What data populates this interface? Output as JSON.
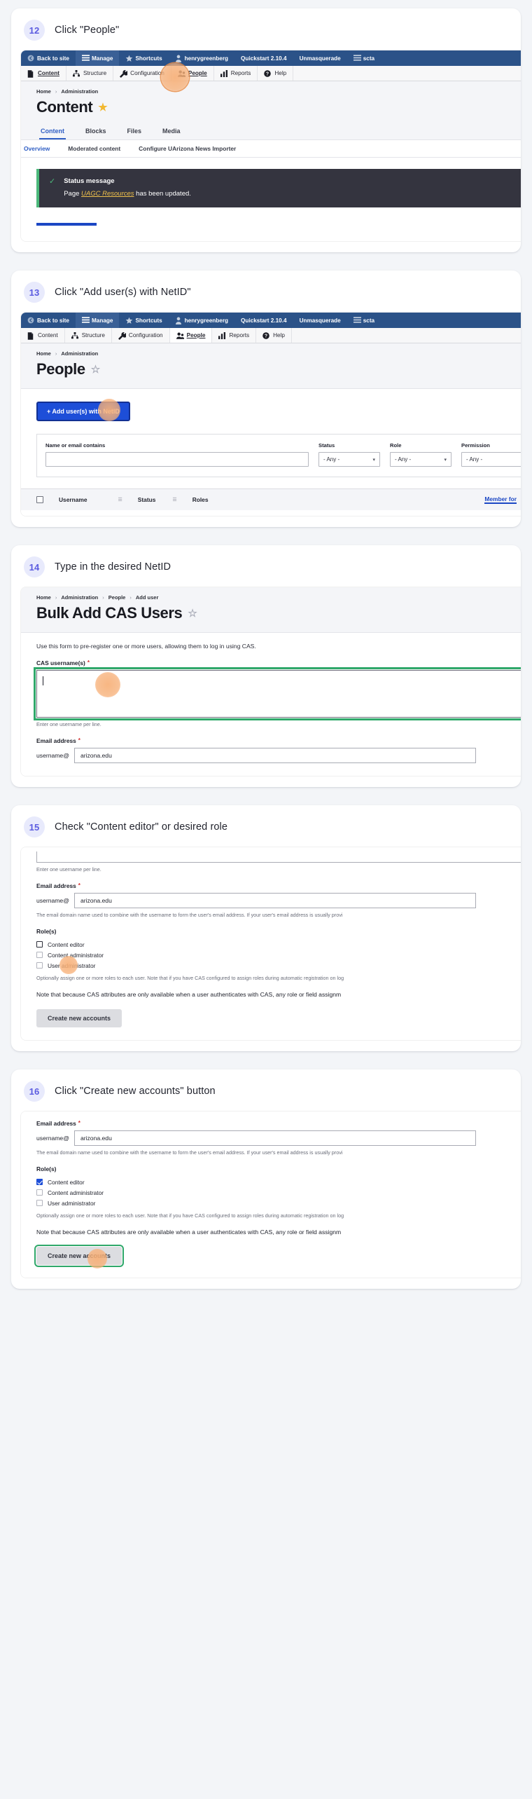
{
  "toolbar": {
    "back_to_site": "Back to site",
    "manage": "Manage",
    "shortcuts": "Shortcuts",
    "user": "henrygreenberg",
    "quickstart": "Quickstart 2.10.4",
    "unmasquerade": "Unmasquerade",
    "truncated": "scta"
  },
  "admin_menu": {
    "content": "Content",
    "structure": "Structure",
    "configuration": "Configuration",
    "people": "People",
    "reports": "Reports",
    "help": "Help"
  },
  "steps": [
    {
      "num": "12",
      "text": "Click \"People\""
    },
    {
      "num": "13",
      "text": "Click \"Add user(s) with NetID\""
    },
    {
      "num": "14",
      "text": "Type in the desired NetID"
    },
    {
      "num": "15",
      "text": "Check \"Content editor\" or desired role"
    },
    {
      "num": "16",
      "text": "Click \"Create new accounts\" button"
    }
  ],
  "content_page": {
    "crumb_home": "Home",
    "crumb_admin": "Administration",
    "title": "Content",
    "tabs": [
      "Content",
      "Blocks",
      "Files",
      "Media"
    ],
    "subtabs": [
      "Overview",
      "Moderated content",
      "Configure UArizona News Importer"
    ],
    "status_title": "Status message",
    "status_prefix": "Page ",
    "status_link": "UAGC Resources",
    "status_suffix": " has been updated."
  },
  "people_page": {
    "crumb_home": "Home",
    "crumb_admin": "Administration",
    "title": "People",
    "add_button": "+ Add user(s) with NetID",
    "filters": [
      {
        "label": "Name or email contains",
        "value": "",
        "type": "text"
      },
      {
        "label": "Status",
        "value": "- Any -",
        "type": "select"
      },
      {
        "label": "Role",
        "value": "- Any -",
        "type": "select"
      },
      {
        "label": "Permission",
        "value": "- Any -",
        "type": "select"
      }
    ],
    "columns": [
      "Username",
      "Status",
      "Roles",
      "Member for"
    ]
  },
  "cas_form": {
    "crumbs": [
      "Home",
      "Administration",
      "People",
      "Add user"
    ],
    "title": "Bulk Add CAS Users",
    "intro": "Use this form to pre-register one or more users, allowing them to log in using CAS.",
    "username_label": "CAS username(s)",
    "username_value": "",
    "username_help": "Enter one username per line.",
    "email_label": "Email address",
    "email_prefix": "username@",
    "email_value": "arizona.edu",
    "email_help": "The email domain name used to combine with the username to form the user's email address. If your user's email address is usually provi",
    "roles_label": "Role(s)",
    "roles": [
      {
        "label": "Content editor",
        "checked_step15": false,
        "checked_step16": true
      },
      {
        "label": "Content administrator",
        "checked_step15": false,
        "checked_step16": false
      },
      {
        "label": "User administrator",
        "checked_step15": false,
        "checked_step16": false
      }
    ],
    "roles_help": "Optionally assign one or more roles to each user. Note that if you have CAS configured to assign roles during automatic registration on log",
    "note": "Note that because CAS attributes are only available when a user authenticates with CAS, any role or field assignm",
    "submit": "Create new accounts"
  },
  "colors": {
    "toolbar_blue": "#2b5288",
    "primary_blue": "#1d4ed8",
    "accent_green": "#2fa86a",
    "highlight_orange": "#f7b078",
    "step_number": "#5b5be0"
  }
}
